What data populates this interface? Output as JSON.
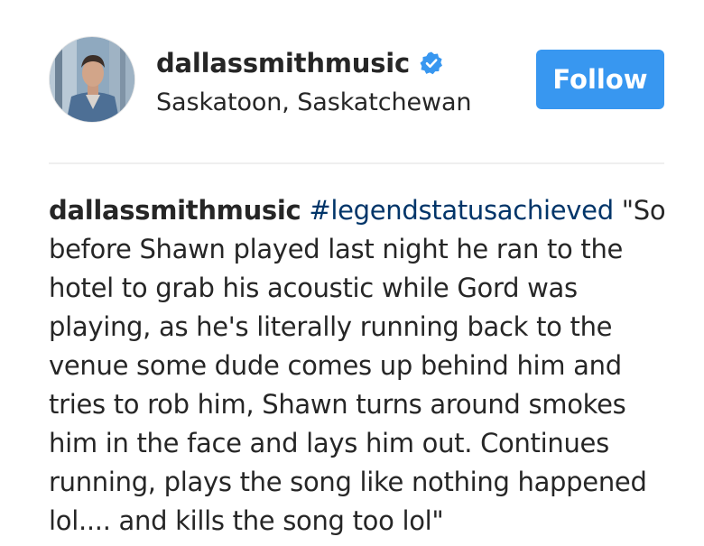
{
  "post": {
    "username": "dallassmithmusic",
    "location": "Saskatoon, Saskatchewan",
    "follow_label": "Follow",
    "caption": {
      "username": "dallassmithmusic",
      "hashtag": "#legendstatusachieved",
      "text": " \"So before Shawn played last night he ran to the hotel to grab his acoustic while Gord was playing, as he's literally running back to the venue some dude comes up behind him and tries to rob him, Shawn turns around smokes him in the face and lays him out. Continues running, plays the song like nothing happened lol.... and kills the song too lol\""
    }
  },
  "icons": {
    "verified": "verified-badge-icon",
    "avatar": "profile-photo"
  },
  "colors": {
    "follow_button": "#3897f0",
    "hashtag": "#003569",
    "verified_badge": "#3897f0",
    "text": "#262626",
    "divider": "#efefef"
  }
}
